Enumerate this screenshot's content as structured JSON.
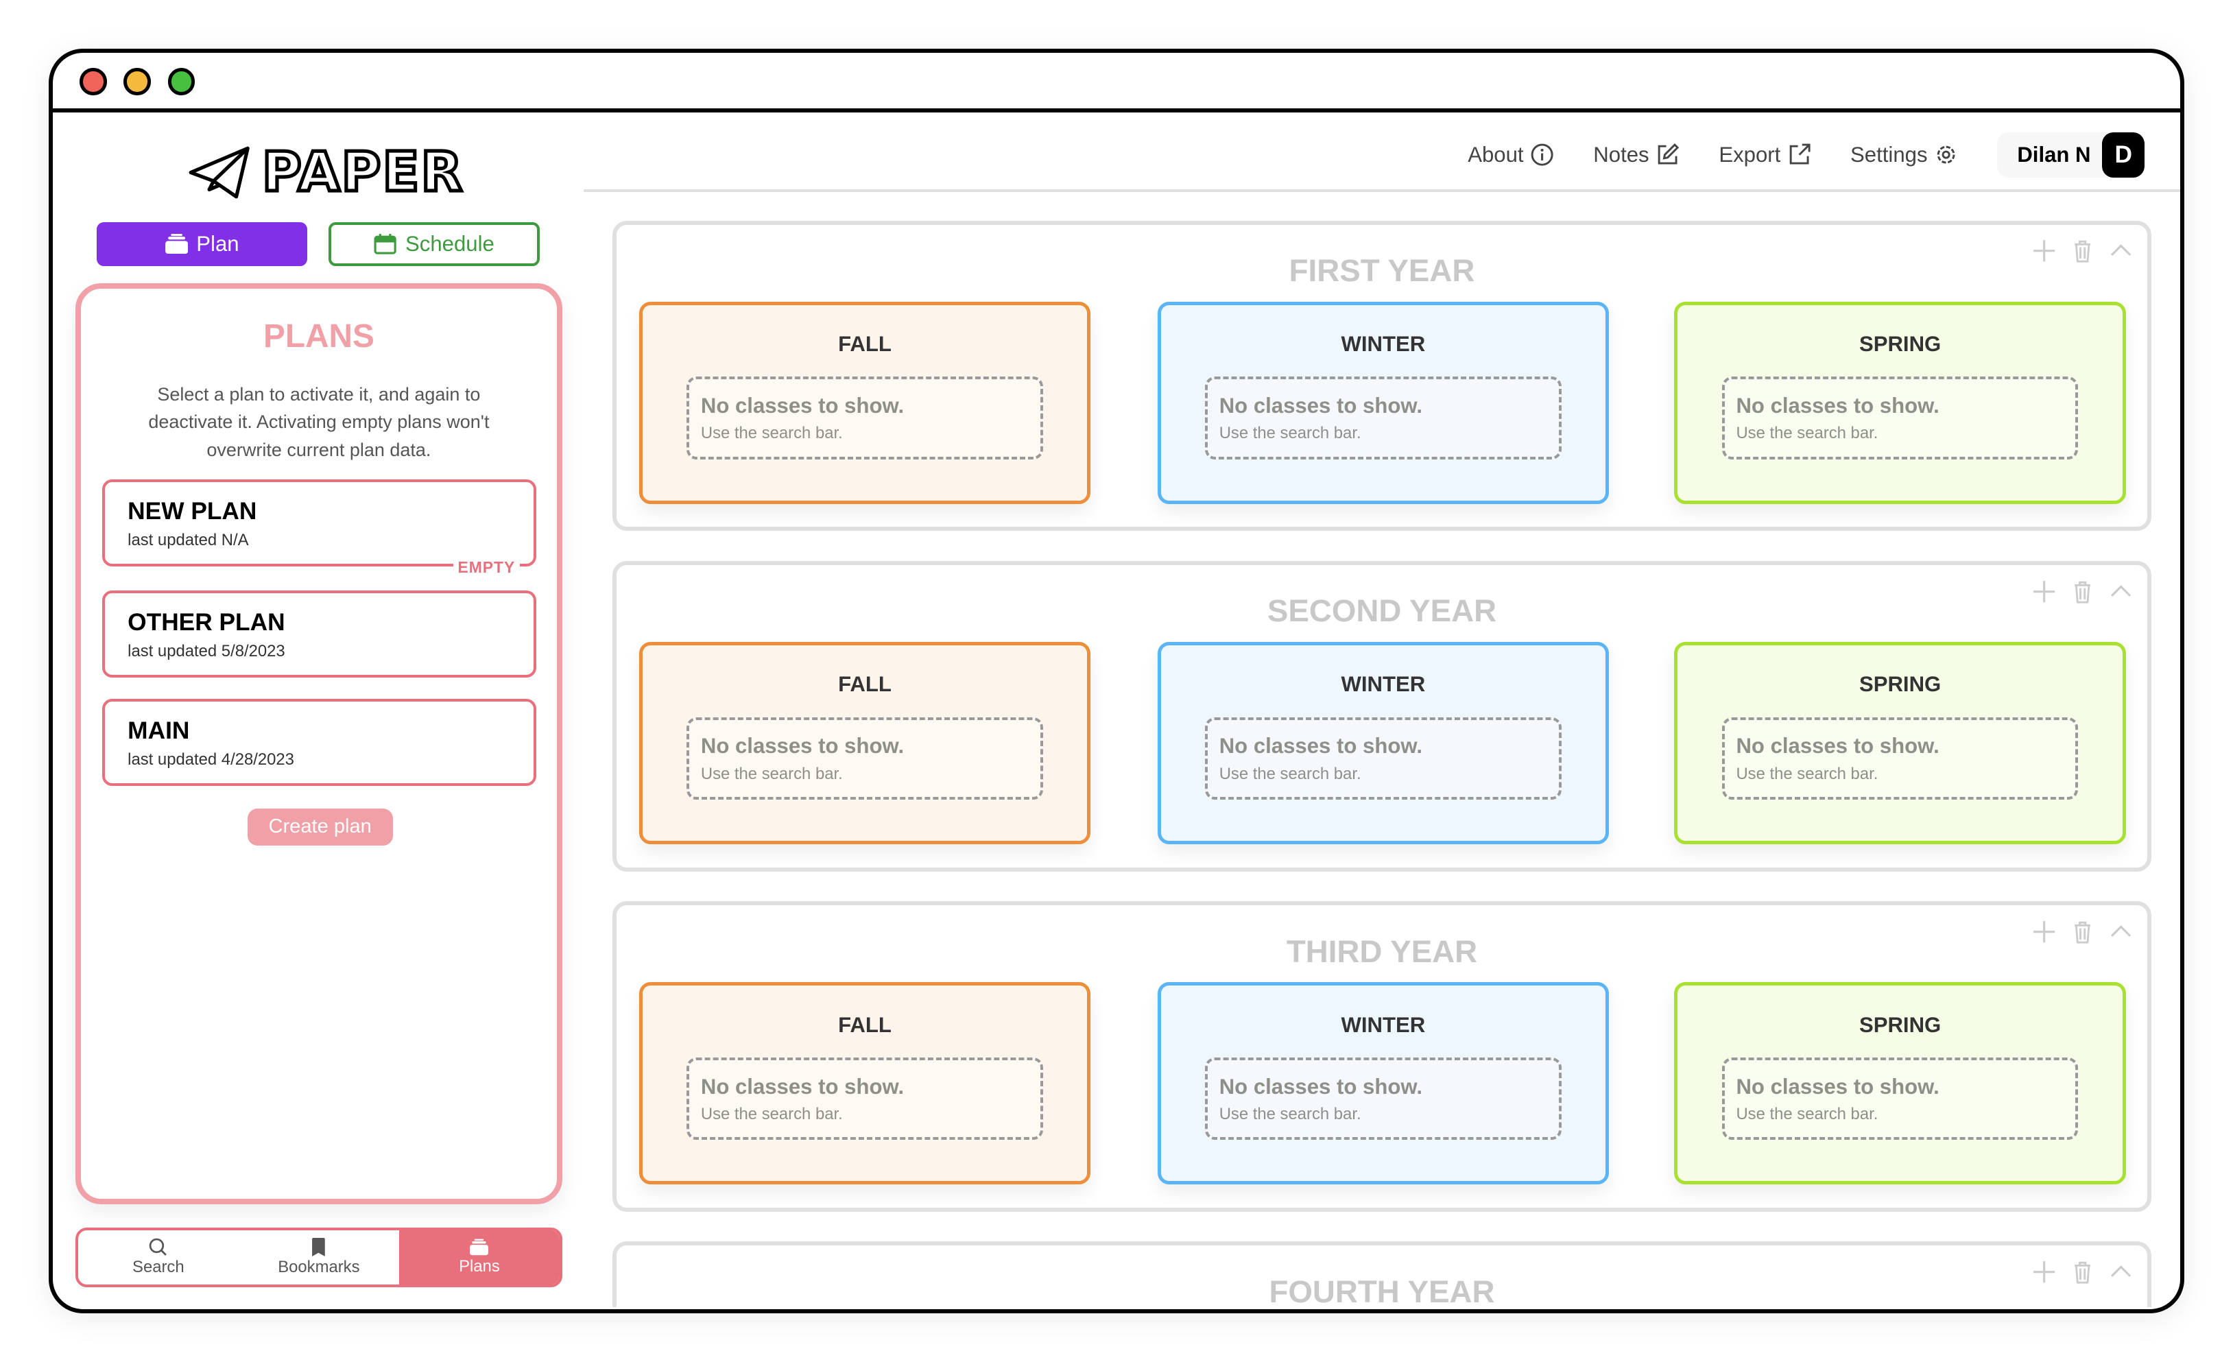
{
  "window": {
    "dots": [
      "#f0645a",
      "#f5b93d",
      "#47c03f"
    ]
  },
  "logo": {
    "text": "PAPER"
  },
  "modes": {
    "plan": "Plan",
    "schedule": "Schedule"
  },
  "colors": {
    "plan_purple": "#8230e6",
    "schedule_green": "#3d9a3d",
    "pink": "#f0a0a6",
    "pink_dark": "#e86f7c"
  },
  "plans_panel": {
    "title": "PLANS",
    "description": "Select a plan to activate it, and again to deactivate it. Activating empty plans won't overwrite current plan data.",
    "plans": [
      {
        "name": "NEW PLAN",
        "updated": "last updated N/A",
        "tag": "EMPTY"
      },
      {
        "name": "OTHER PLAN",
        "updated": "last updated 5/8/2023"
      },
      {
        "name": "MAIN",
        "updated": "last updated 4/28/2023"
      }
    ],
    "create_label": "Create plan"
  },
  "bottom_tabs": [
    {
      "label": "Search",
      "icon": "search-icon"
    },
    {
      "label": "Bookmarks",
      "icon": "bookmark-icon"
    },
    {
      "label": "Plans",
      "icon": "stack-icon",
      "active": true
    }
  ],
  "nav": {
    "about": "About",
    "notes": "Notes",
    "export": "Export",
    "settings": "Settings",
    "user_name": "Dilan N",
    "avatar_letter": "D"
  },
  "semesters": [
    {
      "name": "FALL",
      "border": "#ed8f3a",
      "bg": "#fdf5eb"
    },
    {
      "name": "WINTER",
      "border": "#5ab4f5",
      "bg": "#eef6fe"
    },
    {
      "name": "SPRING",
      "border": "#a8e22f",
      "bg": "#f6fde6"
    }
  ],
  "empty": {
    "title": "No classes to show.",
    "subtitle": "Use the search bar."
  },
  "years": [
    "FIRST YEAR",
    "SECOND YEAR",
    "THIRD YEAR",
    "FOURTH YEAR"
  ]
}
